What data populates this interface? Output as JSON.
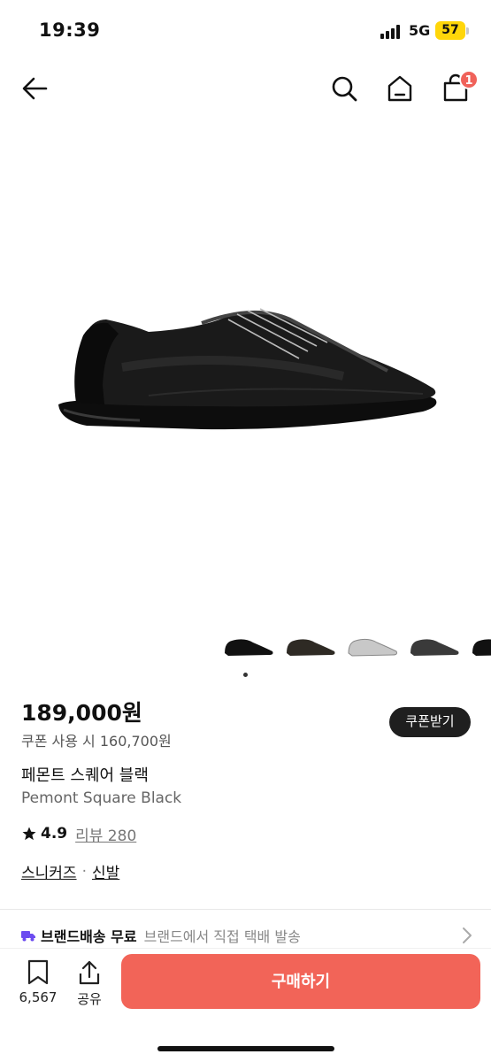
{
  "status_bar": {
    "time": "19:39",
    "network": "5G",
    "battery": "57"
  },
  "nav": {
    "back_icon": "arrow-left-icon",
    "search_icon": "search-icon",
    "home_icon": "home-icon",
    "cart_icon": "shopping-bag-icon",
    "cart_count": "1"
  },
  "product": {
    "price": "189,000원",
    "coupon_button": "쿠폰받기",
    "coupon_price": "쿠폰 사용 시 160,700원",
    "name_ko": "페몬트 스퀘어 블랙",
    "name_en": "Pemont Square Black",
    "rating": "4.9",
    "review": "리뷰 280",
    "categories": [
      "스니커즈",
      "신발"
    ],
    "category_separator": "·"
  },
  "shipping": {
    "main": "브랜드배송 무료",
    "desc": "브랜드에서 직접 택배 발송"
  },
  "bottom_bar": {
    "bookmark_count": "6,567",
    "share_label": "공유",
    "buy_label": "구매하기"
  },
  "colors": {
    "accent": "#f26458",
    "badge": "#f0625a",
    "shipping_truck": "#6c4cf0",
    "battery": "#ffd60a"
  }
}
